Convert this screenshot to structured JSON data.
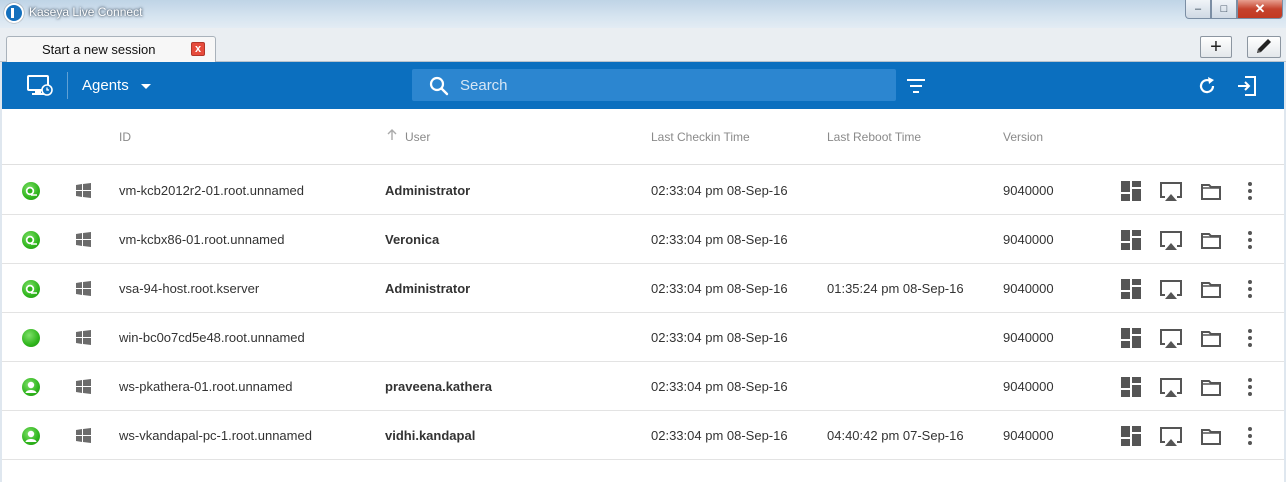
{
  "window": {
    "title": "Kaseya Live Connect",
    "min_label": "–",
    "max_label": "□",
    "close_label": "✕"
  },
  "tabs": [
    {
      "label": "Start a new session",
      "close_label": "x"
    }
  ],
  "tabstrip": {
    "add_label": "+"
  },
  "toolbar": {
    "view_label": "Agents",
    "search_placeholder": "Search"
  },
  "table": {
    "columns": {
      "id": "ID",
      "user": "User",
      "last_checkin": "Last Checkin Time",
      "last_reboot": "Last Reboot Time",
      "version": "Version"
    },
    "sort": {
      "column": "user",
      "direction": "ascending"
    },
    "rows": [
      {
        "status_icon": "agent-user-icon",
        "os_icon": "windows-icon",
        "id": "vm-kcb2012r2-01.root.unnamed",
        "user": "Administrator",
        "last_checkin": "02:33:04 pm 08-Sep-16",
        "last_reboot": "",
        "version": "9040000"
      },
      {
        "status_icon": "agent-user-icon",
        "os_icon": "windows-icon",
        "id": "vm-kcbx86-01.root.unnamed",
        "user": "Veronica",
        "last_checkin": "02:33:04 pm 08-Sep-16",
        "last_reboot": "",
        "version": "9040000"
      },
      {
        "status_icon": "agent-user-icon",
        "os_icon": "windows-icon",
        "id": "vsa-94-host.root.kserver",
        "user": "Administrator",
        "last_checkin": "02:33:04 pm 08-Sep-16",
        "last_reboot": "01:35:24 pm 08-Sep-16",
        "version": "9040000"
      },
      {
        "status_icon": "agent-online-icon",
        "os_icon": "windows-icon",
        "id": "win-bc0o7cd5e48.root.unnamed",
        "user": "",
        "last_checkin": "02:33:04 pm 08-Sep-16",
        "last_reboot": "",
        "version": "9040000"
      },
      {
        "status_icon": "agent-person-icon",
        "os_icon": "windows-icon",
        "id": "ws-pkathera-01.root.unnamed",
        "user": "praveena.kathera",
        "last_checkin": "02:33:04 pm 08-Sep-16",
        "last_reboot": "",
        "version": "9040000"
      },
      {
        "status_icon": "agent-person-icon",
        "os_icon": "windows-icon",
        "id": "ws-vkandapal-pc-1.root.unnamed",
        "user": "vidhi.kandapal",
        "last_checkin": "02:33:04 pm 08-Sep-16",
        "last_reboot": "04:40:42 pm 07-Sep-16",
        "version": "9040000"
      }
    ]
  },
  "colors": {
    "toolbar": "#0b6fbf",
    "search_bg": "#2c86d0",
    "status_online": "#2fb51c",
    "icon_gray": "#555555"
  }
}
